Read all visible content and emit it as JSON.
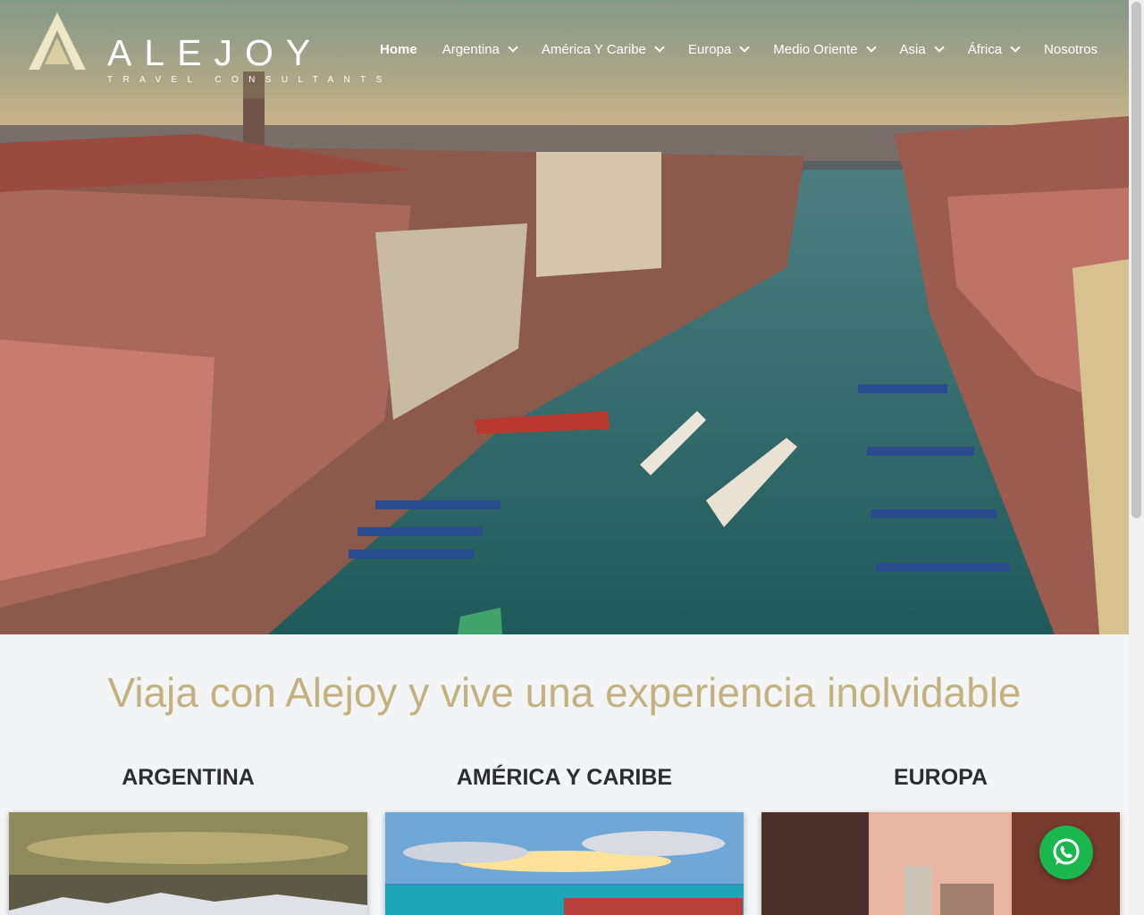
{
  "brand": {
    "name": "ALEJOY",
    "tagline": "TRAVEL CONSULTANTS",
    "gold": "#c2b27f"
  },
  "nav": {
    "items": [
      {
        "label": "Home",
        "has_dropdown": false
      },
      {
        "label": "Argentina",
        "has_dropdown": true
      },
      {
        "label": "América Y Caribe",
        "has_dropdown": true
      },
      {
        "label": "Europa",
        "has_dropdown": true
      },
      {
        "label": "Medio Oriente",
        "has_dropdown": true
      },
      {
        "label": "Asia",
        "has_dropdown": true
      },
      {
        "label": "África",
        "has_dropdown": true
      },
      {
        "label": "Nosotros",
        "has_dropdown": false
      }
    ]
  },
  "main": {
    "headline": "Viaja con Alejoy y vive una experiencia inolvidable",
    "destinations": [
      {
        "title": "ARGENTINA"
      },
      {
        "title": "AMÉRICA Y CARIBE"
      },
      {
        "title": "EUROPA"
      }
    ]
  },
  "whatsapp": {
    "icon": "whatsapp-icon",
    "color": "#1ab74f"
  }
}
